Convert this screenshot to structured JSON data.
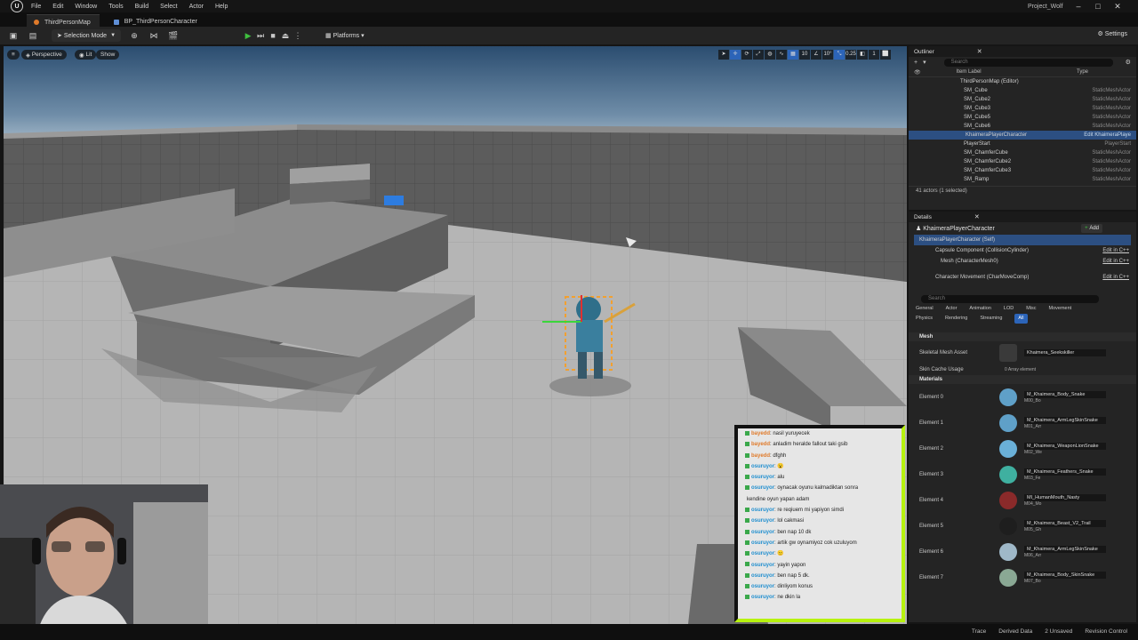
{
  "menu": [
    "File",
    "Edit",
    "Window",
    "Tools",
    "Build",
    "Select",
    "Actor",
    "Help"
  ],
  "project_name": "Project_Wolf",
  "tabs": [
    {
      "label": "ThirdPersonMap"
    },
    {
      "label": "BP_ThirdPersonCharacter"
    }
  ],
  "toolbar": {
    "selection_mode": "Selection Mode",
    "platforms": "Platforms",
    "settings": "Settings"
  },
  "viewport": {
    "perspective": "Perspective",
    "lit": "Lit",
    "show": "Show",
    "grid_snap": "10",
    "rot_snap": "10°",
    "scale_snap": "0.25",
    "cam_speed": "1"
  },
  "outliner": {
    "tab": "Outliner",
    "search_placeholder": "Search",
    "col_label": "Item Label",
    "col_type": "Type",
    "map_row": "ThirdPersonMap (Editor)",
    "rows": [
      {
        "name": "SM_Cube",
        "type": "StaticMeshActor"
      },
      {
        "name": "SM_Cube2",
        "type": "StaticMeshActor"
      },
      {
        "name": "SM_Cube3",
        "type": "StaticMeshActor"
      },
      {
        "name": "SM_Cube5",
        "type": "StaticMeshActor"
      },
      {
        "name": "SM_Cube6",
        "type": "StaticMeshActor"
      },
      {
        "name": "KhaimeraPlayerCharacter",
        "type": "Edit KhaimeraPlaye"
      },
      {
        "name": "PlayerStart",
        "type": "PlayerStart"
      },
      {
        "name": "SM_ChamferCube",
        "type": "StaticMeshActor"
      },
      {
        "name": "SM_ChamferCube2",
        "type": "StaticMeshActor"
      },
      {
        "name": "SM_ChamferCube3",
        "type": "StaticMeshActor"
      },
      {
        "name": "SM_Ramp",
        "type": "StaticMeshActor"
      }
    ],
    "count": "41 actors (1 selected)"
  },
  "details": {
    "tab": "Details",
    "actor_name": "KhaimeraPlayerCharacter",
    "add_label": "Add",
    "self_row": "KhaimeraPlayerCharacter (Self)",
    "components": [
      {
        "name": "Capsule Component (CollisionCylinder)",
        "edit": "Edit in C++"
      },
      {
        "name": "Mesh (CharacterMesh0)",
        "edit": "Edit in C++"
      },
      {
        "name": "Character Movement (CharMoveComp)",
        "edit": "Edit in C++"
      }
    ],
    "search_placeholder": "Search",
    "filters_row1": [
      "General",
      "Actor",
      "Animation",
      "LOD",
      "Misc",
      "Movement"
    ],
    "filters_row2": [
      "Physics",
      "Rendering",
      "Streaming",
      "All"
    ],
    "mesh_section": "Mesh",
    "skeletal_mesh_label": "Skeletal Mesh Asset",
    "skeletal_mesh_value": "Khaimera_Seekskiller",
    "skin_cache_label": "Skin Cache Usage",
    "skin_cache_value": "0 Array element",
    "materials_section": "Materials",
    "materials": [
      {
        "label": "Element 0",
        "name": "M_Khaimera_Body_Snake",
        "slot": "M00_Bo",
        "color": "#5fa0c8"
      },
      {
        "label": "Element 1",
        "name": "M_Khaimera_ArmLegSkinSnake",
        "slot": "M01_Arr",
        "color": "#5fa0c8"
      },
      {
        "label": "Element 2",
        "name": "M_Khaimera_WeaponLionSnake",
        "slot": "M02_We",
        "color": "#6ab0d8"
      },
      {
        "label": "Element 3",
        "name": "M_Khaimera_Feathers_Snake",
        "slot": "M03_Fe",
        "color": "#3fb0a0"
      },
      {
        "label": "Element 4",
        "name": "MI_HumanMouth_Nasty",
        "slot": "M04_Mo",
        "color": "#8a2a2a"
      },
      {
        "label": "Element 5",
        "name": "M_Khaimera_Beast_V2_Trail",
        "slot": "M05_Gh",
        "color": "#1e1e1e"
      },
      {
        "label": "Element 6",
        "name": "M_Khaimera_ArmLegSkinSnake",
        "slot": "M06_Arr",
        "color": "#9fb8c8"
      },
      {
        "label": "Element 7",
        "name": "M_Khaimera_Body_SkinSnake",
        "slot": "M07_Bo",
        "color": "#8aa894"
      }
    ]
  },
  "status": [
    "Trace",
    "Derived Data",
    "2 Unsaved",
    "Revision Control"
  ],
  "chat": [
    {
      "user": "bayedd",
      "msg": ": nasil yuruyecek",
      "orange": true
    },
    {
      "user": "bayedd",
      "msg": ": anladim heralde fallout taki gsib",
      "orange": true
    },
    {
      "user": "bayedd",
      "msg": ": dfghh",
      "orange": true
    },
    {
      "user": "osuruyor",
      "msg": ": 😮",
      "orange": false
    },
    {
      "user": "osuruyor",
      "msg": ": alu",
      "orange": false
    },
    {
      "user": "osuruyor",
      "msg": ": oynacak oyunu kalmadiktan sonra",
      "orange": false
    },
    {
      "user": "",
      "msg": "kendine oyun yapan adam",
      "orange": false
    },
    {
      "user": "osuruyor",
      "msg": ": re reqiuem mi yapiyon simdi",
      "orange": false
    },
    {
      "user": "osuruyor",
      "msg": ": lol cakmasi",
      "orange": false
    },
    {
      "user": "osuruyor",
      "msg": ": ben nap 10 dk",
      "orange": false
    },
    {
      "user": "osuruyor",
      "msg": ": artik gw oynamiyoz cok uzuluyom",
      "orange": false
    },
    {
      "user": "osuruyor",
      "msg": ": 😐",
      "orange": false
    },
    {
      "user": "osuruyor",
      "msg": ": yayin yapon",
      "orange": false
    },
    {
      "user": "osuruyor",
      "msg": ": ben nap 5 dk.",
      "orange": false
    },
    {
      "user": "osuruyor",
      "msg": ": dinliyom konus",
      "orange": false
    },
    {
      "user": "osuruyor",
      "msg": ": ne dkin la",
      "orange": false
    }
  ]
}
